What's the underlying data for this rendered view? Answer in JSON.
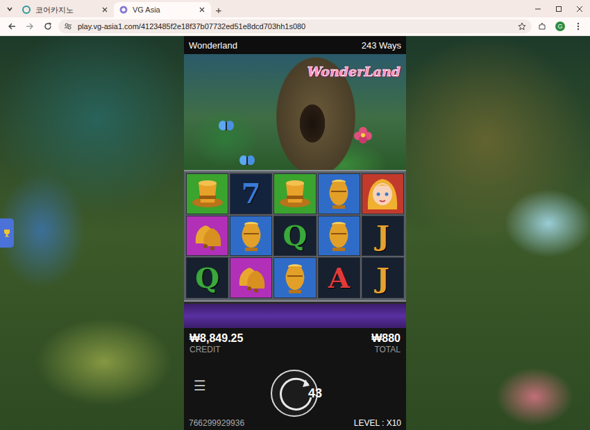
{
  "browser": {
    "tabs": [
      {
        "label": "코어카지노",
        "selected": false
      },
      {
        "label": "VG Asia",
        "selected": true
      }
    ],
    "new_tab": "+",
    "url": "play.vg-asia1.com/4123485f2e18f37b07732ed51e8dcd703hh1s080",
    "profile": "G"
  },
  "game": {
    "title": "Wonderland",
    "ways": "243 Ways",
    "logo": "WonderLand",
    "reels": [
      [
        {
          "kind": "hat",
          "color": "#3aa42e"
        },
        {
          "kind": "card",
          "text": "7",
          "color": "#14233d"
        },
        {
          "kind": "hat",
          "color": "#3aa42e"
        },
        {
          "kind": "pot",
          "color": "#2f6cc8"
        },
        {
          "kind": "alice",
          "color": "#c23a2c"
        }
      ],
      [
        {
          "kind": "bell",
          "color": "#b22fb8"
        },
        {
          "kind": "pot",
          "color": "#2f6cc8"
        },
        {
          "kind": "card",
          "text": "Q",
          "color": "#16202e"
        },
        {
          "kind": "pot",
          "color": "#2f6cc8"
        },
        {
          "kind": "card",
          "text": "J",
          "color": "#16202e"
        }
      ],
      [
        {
          "kind": "card",
          "text": "Q",
          "color": "#16202e"
        },
        {
          "kind": "bell",
          "color": "#b22fb8"
        },
        {
          "kind": "pot",
          "color": "#2f6cc8"
        },
        {
          "kind": "card",
          "text": "A",
          "color": "#16202e"
        },
        {
          "kind": "card",
          "text": "J",
          "color": "#16202e"
        }
      ]
    ],
    "credit": {
      "value": "₩8,849.25",
      "label": "CREDIT"
    },
    "total": {
      "value": "₩880",
      "label": "TOTAL"
    },
    "menu": "☰",
    "spin_count": "43",
    "round_id": "766299929936",
    "level": "LEVEL : X10"
  }
}
